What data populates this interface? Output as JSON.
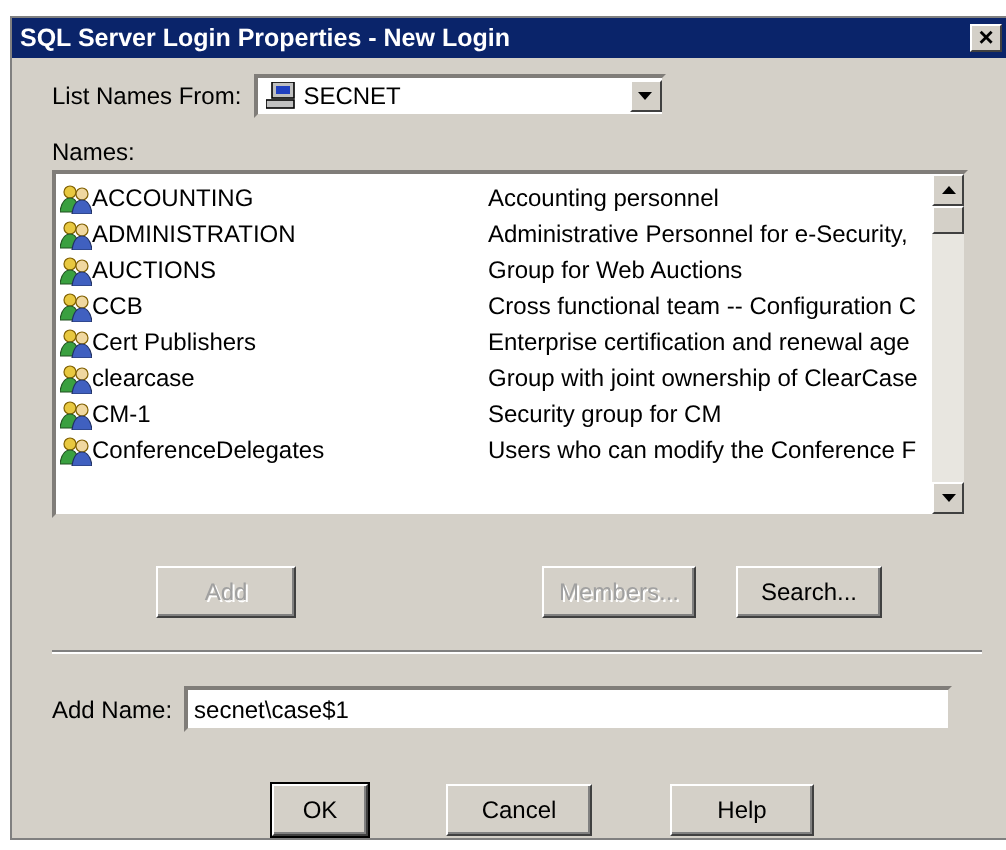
{
  "window": {
    "title": "SQL Server Login Properties - New Login",
    "close": "×"
  },
  "list_names_from": {
    "label": "List Names From:",
    "value": "SECNET"
  },
  "names": {
    "label": "Names:",
    "rows": [
      {
        "name": "ACCOUNTING",
        "description": "Accounting personnel"
      },
      {
        "name": "ADMINISTRATION",
        "description": "Administrative Personnel for e-Security,"
      },
      {
        "name": "AUCTIONS",
        "description": "Group for Web Auctions"
      },
      {
        "name": "CCB",
        "description": "Cross functional team -- Configuration C"
      },
      {
        "name": "Cert Publishers",
        "description": "Enterprise certification and renewal age"
      },
      {
        "name": "clearcase",
        "description": "Group with joint ownership of ClearCase"
      },
      {
        "name": "CM-1",
        "description": "Security group for CM"
      },
      {
        "name": "ConferenceDelegates",
        "description": "Users who can modify the Conference F"
      }
    ]
  },
  "list_buttons": [
    {
      "label": "Add",
      "disabled": true
    },
    {
      "label": "Members...",
      "disabled": true
    },
    {
      "label": "Search...",
      "disabled": false
    }
  ],
  "add_name": {
    "label": "Add Name:",
    "value": "secnet\\case$1"
  },
  "buttons": [
    {
      "label": "OK",
      "default": true
    },
    {
      "label": "Cancel",
      "default": false
    },
    {
      "label": "Help",
      "default": false
    }
  ]
}
